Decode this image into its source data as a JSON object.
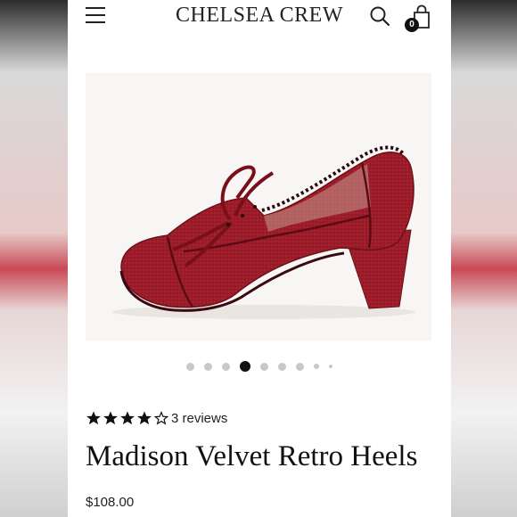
{
  "header": {
    "brand": "CHELSEA CREW",
    "cart_count": "0",
    "icons": [
      "menu-icon",
      "search-icon",
      "shopping-bag-icon"
    ]
  },
  "product": {
    "rating_stars": 4,
    "rating_max": 5,
    "reviews_label": "3 reviews",
    "title": "Madison Velvet Retro Heels",
    "price": "$108.00"
  },
  "gallery": {
    "dot_count": 9,
    "active_index": 3
  },
  "colors": {
    "velvet": "#9c1c2a",
    "active_dot": "#111111",
    "inactive_dot": "#c8c8c8"
  }
}
